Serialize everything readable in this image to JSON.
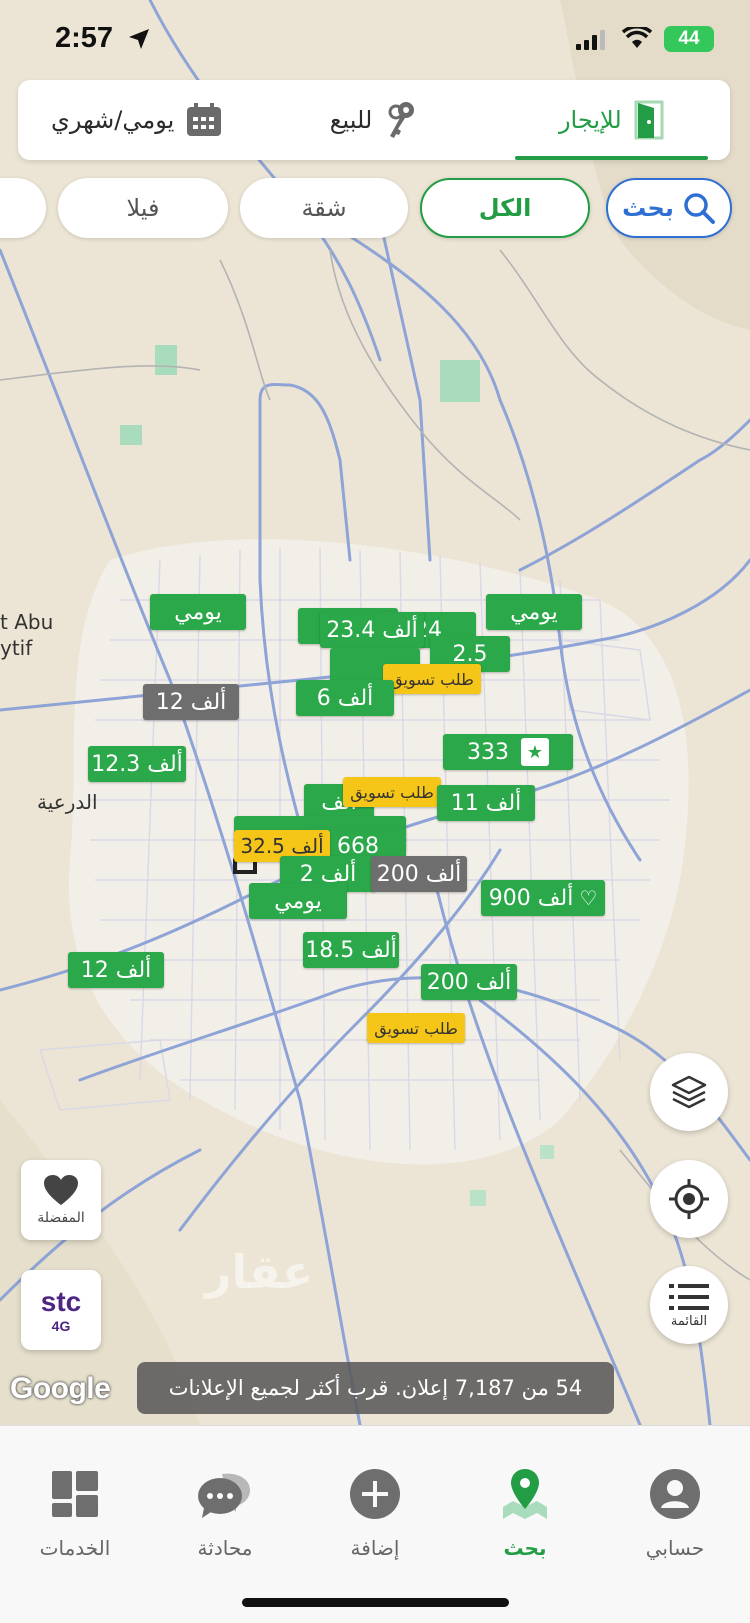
{
  "status_bar": {
    "time": "2:57",
    "battery": "44"
  },
  "tabs": [
    {
      "label": "للإيجار",
      "icon": "door-icon",
      "active": true
    },
    {
      "label": "للبيع",
      "icon": "keys-icon",
      "active": false
    },
    {
      "label": "يومي/شهري",
      "icon": "calendar-icon",
      "active": false
    }
  ],
  "filters": {
    "search_label": "بحث",
    "chips": [
      "الكل",
      "شقة",
      "فيلا"
    ]
  },
  "map": {
    "place_labels": {
      "diriyah": "الدرعية",
      "abu_1": "t Abu",
      "abu_2": "ytif"
    },
    "pins": [
      {
        "label": "يومي",
        "type": "green"
      },
      {
        "label": "يومي",
        "type": "green"
      },
      {
        "label": "24",
        "type": "green"
      },
      {
        "label": "23.4 ألف",
        "type": "green"
      },
      {
        "label": "2.5",
        "type": "green"
      },
      {
        "label": "طلب تسويق",
        "type": "yellow"
      },
      {
        "label": "12 ألف",
        "type": "gray"
      },
      {
        "label": "6 ألف",
        "type": "green"
      },
      {
        "label": "333",
        "type": "green-star"
      },
      {
        "label": "12.3 ألف",
        "type": "green"
      },
      {
        "label": "ألف",
        "type": "green"
      },
      {
        "label": "طلب تسويق",
        "type": "yellow"
      },
      {
        "label": "11 ألف",
        "type": "green"
      },
      {
        "label": "668",
        "type": "green"
      },
      {
        "label": "32.5 ألف",
        "type": "yellow"
      },
      {
        "label": "2 ألف",
        "type": "green"
      },
      {
        "label": "200 ألف",
        "type": "gray"
      },
      {
        "label": "900 ألف",
        "type": "green-heart"
      },
      {
        "label": "يومي",
        "type": "green"
      },
      {
        "label": "18.5 ألف",
        "type": "green"
      },
      {
        "label": "12 ألف",
        "type": "green"
      },
      {
        "label": "200 ألف",
        "type": "green"
      },
      {
        "label": "طلب تسويق",
        "type": "yellow"
      }
    ]
  },
  "controls": {
    "favorites_label": "المفضلة",
    "list_label": "القائمة",
    "stc_label": "stc",
    "stc_network": "4G",
    "layers_icon": "layers-icon",
    "locate_icon": "locate-icon"
  },
  "google_label": "Google",
  "watermark": "عقار",
  "results_text": "54 من 7,187 إعلان. قرب أكثر لجميع الإعلانات",
  "bottom_nav": [
    {
      "label": "حسابي",
      "icon": "user-icon",
      "active": false
    },
    {
      "label": "بحث",
      "icon": "map-pin-icon",
      "active": true
    },
    {
      "label": "إضافة",
      "icon": "plus-icon",
      "active": false
    },
    {
      "label": "محادثة",
      "icon": "chat-icon",
      "active": false
    },
    {
      "label": "الخدمات",
      "icon": "grid-icon",
      "active": false
    }
  ],
  "colors": {
    "brand_green": "#239d45",
    "pin_green": "#2ba84a",
    "pin_gray": "#6e6e6e",
    "pin_yellow": "#f5c518",
    "search_blue": "#2f6fd3"
  }
}
